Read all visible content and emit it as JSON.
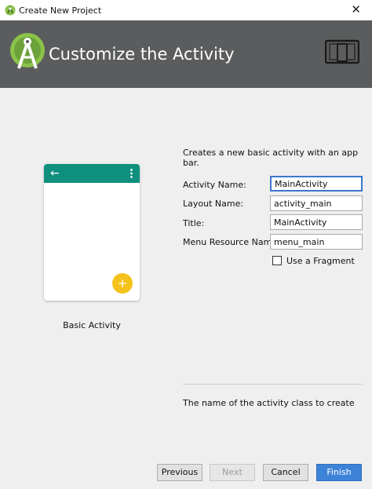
{
  "window": {
    "title": "Create New Project",
    "close_glyph": "✕"
  },
  "header": {
    "title": "Customize the Activity"
  },
  "preview": {
    "back_glyph": "←",
    "fab_glyph": "+",
    "template_name": "Basic Activity"
  },
  "form": {
    "description": "Creates a new basic activity with an app bar.",
    "fields": [
      {
        "label": "Activity Name:",
        "value": "MainActivity"
      },
      {
        "label": "Layout Name:",
        "value": "activity_main"
      },
      {
        "label": "Title:",
        "value": "MainActivity"
      },
      {
        "label": "Menu Resource Name:",
        "value": "menu_main"
      }
    ],
    "fragment_checkbox": {
      "label": "Use a Fragment",
      "checked": false
    },
    "help_text": "The name of the activity class to create"
  },
  "buttons": {
    "previous": "Previous",
    "next": "Next",
    "cancel": "Cancel",
    "finish": "Finish"
  },
  "colors": {
    "header_bg": "#5b5c5d",
    "appbar_teal": "#0f8f7e",
    "fab_amber": "#f4c21b",
    "primary_button": "#3d84d8",
    "android_green": "#8bc34a"
  }
}
